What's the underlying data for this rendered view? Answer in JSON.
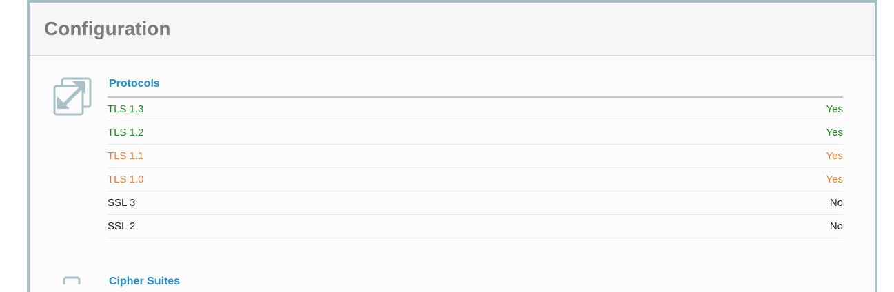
{
  "panel": {
    "title": "Configuration"
  },
  "colors": {
    "border": "#a8c1c6",
    "section_title": "#1b8fd3",
    "good": "#1f8a1f",
    "warning": "#e87d2f",
    "neutral": "#222222",
    "header_text": "#7b7b7b"
  },
  "protocols": {
    "title": "Protocols",
    "icon": "expand-arrows-icon",
    "rows": [
      {
        "name": "TLS 1.3",
        "value": "Yes",
        "status": "good"
      },
      {
        "name": "TLS 1.2",
        "value": "Yes",
        "status": "good"
      },
      {
        "name": "TLS 1.1",
        "value": "Yes",
        "status": "warning"
      },
      {
        "name": "TLS 1.0",
        "value": "Yes",
        "status": "warning"
      },
      {
        "name": "SSL 3",
        "value": "No",
        "status": "neutral"
      },
      {
        "name": "SSL 2",
        "value": "No",
        "status": "neutral"
      }
    ]
  },
  "cipher_suites": {
    "title": "Cipher Suites",
    "icon": "cipher-icon"
  }
}
